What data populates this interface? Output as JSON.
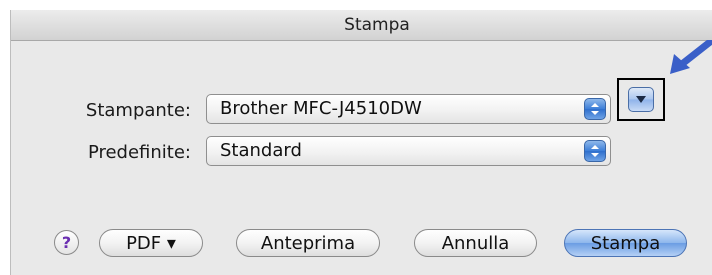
{
  "dialog": {
    "title": "Stampa"
  },
  "printer": {
    "label": "Stampante:",
    "value": "Brother MFC-J4510DW"
  },
  "presets": {
    "label": "Predefinite:",
    "value": "Standard"
  },
  "buttons": {
    "help": "?",
    "pdf": "PDF ▾",
    "preview": "Anteprima",
    "cancel": "Annulla",
    "print": "Stampa"
  },
  "colors": {
    "accent": "#3a5fc8",
    "default_button": "#6b9de3"
  }
}
